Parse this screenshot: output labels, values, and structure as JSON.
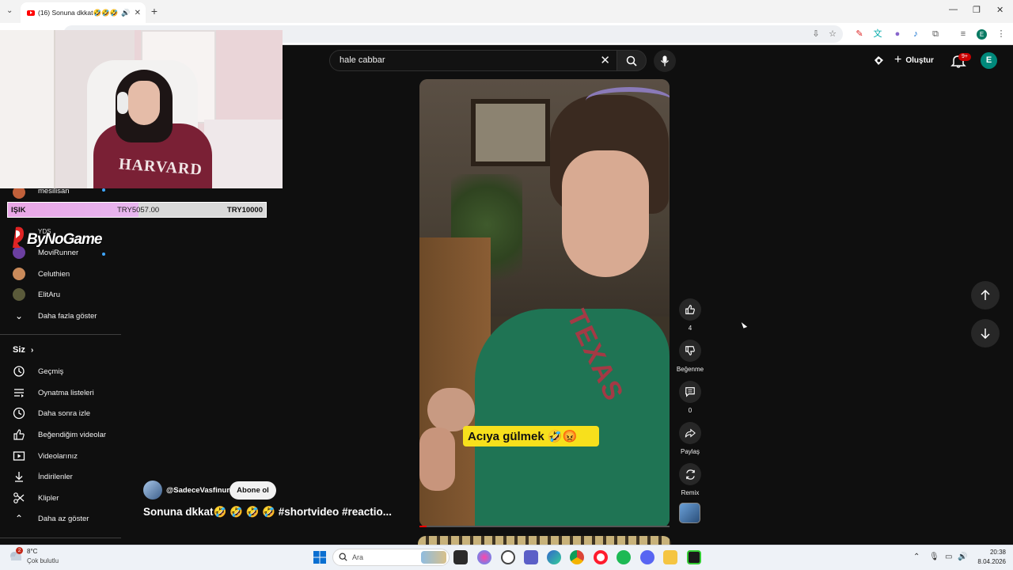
{
  "browser": {
    "tab_title": "(16) Sonuna dkkat🤣🤣🤣",
    "tab_close": "✕",
    "new_tab": "+",
    "window_controls": [
      "—",
      "❐",
      "✕"
    ]
  },
  "header": {
    "search_value": "hale cabbar",
    "create_label": "Oluştur",
    "notification_badge": "9+",
    "avatar_letter": "E"
  },
  "donation": {
    "name": "IŞIK",
    "current": "TRY5057.00",
    "goal": "TRY10000",
    "progress_fraction": 0.5057
  },
  "overlay": {
    "logo_text": "ByNoGame",
    "webcam_print": "HARVARD"
  },
  "sidebar": {
    "partial_channel": "mesilisan",
    "partial_channel_2": "YDS",
    "channels": [
      {
        "label": "MoviRunner",
        "live": true
      },
      {
        "label": "Celuthien",
        "live": false
      },
      {
        "label": "ElitAru",
        "live": false
      }
    ],
    "show_more": "Daha fazla göster",
    "you_section": "Siz",
    "you_items": [
      {
        "label": "Geçmiş",
        "icon": "history-icon"
      },
      {
        "label": "Oynatma listeleri",
        "icon": "playlist-icon"
      },
      {
        "label": "Daha sonra izle",
        "icon": "clock-icon"
      },
      {
        "label": "Beğendiğim videolar",
        "icon": "thumbs-up-icon"
      },
      {
        "label": "Videolarınız",
        "icon": "video-icon"
      },
      {
        "label": "İndirilenler",
        "icon": "download-icon"
      },
      {
        "label": "Klipler",
        "icon": "scissors-icon"
      }
    ],
    "show_less": "Daha az göster"
  },
  "short": {
    "caption": "Acıya gülmek 🤣😡",
    "channel": "@SadeceVasfinur",
    "subscribe_label": "Abone ol",
    "title": "Sonuna dkkat🤣 🤣 🤣 🤣 #shortvideo #reactio...",
    "like_count": "4",
    "dislike_label": "Beğenme",
    "comment_count": "0",
    "share_label": "Paylaş",
    "remix_label": "Remix",
    "progress_fraction": 0.03
  },
  "taskbar": {
    "weather_temp": "8°C",
    "weather_desc": "Çok bulutlu",
    "weather_badge": "2",
    "search_placeholder": "Ara",
    "time": "20:38",
    "date": "8.04.2026"
  },
  "colors": {
    "background": "#0f0f0f",
    "youtube_red": "#ff0000",
    "caption_yellow": "#f7e01c",
    "donation_fill": "#e9a6e6"
  }
}
